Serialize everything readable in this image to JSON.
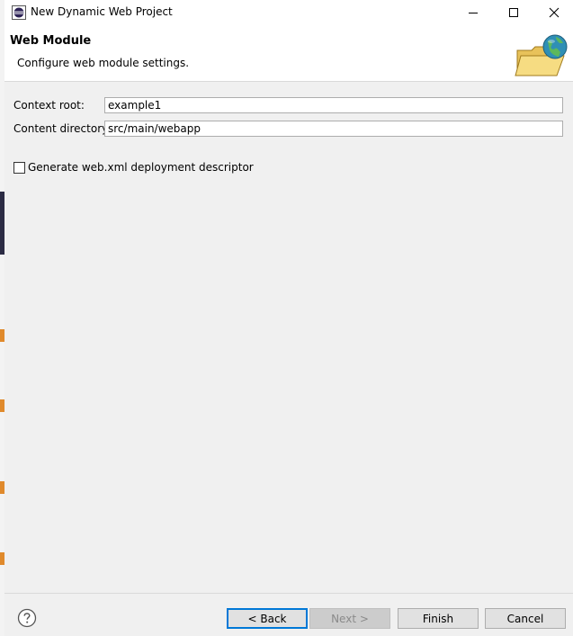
{
  "window": {
    "title": "New Dynamic Web Project"
  },
  "banner": {
    "title": "Web Module",
    "description": "Configure web module settings."
  },
  "form": {
    "context_root": {
      "label": "Context root:",
      "value": "example1"
    },
    "content_directory": {
      "label": "Content directory:",
      "value": "src/main/webapp"
    },
    "generate_descriptor": {
      "label": "Generate web.xml deployment descriptor",
      "checked": false
    }
  },
  "buttons": {
    "back": "< Back",
    "next": "Next >",
    "finish": "Finish",
    "cancel": "Cancel"
  },
  "icons": {
    "app": "eclipse-icon",
    "banner": "web-module-folder-globe-icon",
    "help": "help-icon",
    "minimize": "minimize-icon",
    "maximize": "maximize-icon",
    "close": "close-icon"
  },
  "colors": {
    "accent": "#0078d7",
    "dialog_bg": "#f0f0f0",
    "banner_bg": "#ffffff"
  }
}
